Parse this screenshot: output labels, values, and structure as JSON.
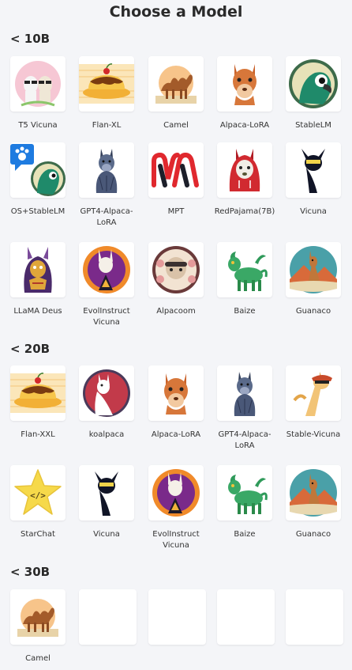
{
  "title": "Choose a Model",
  "sections": [
    {
      "label": "< 10B",
      "models": [
        {
          "name": "T5 Vicuna",
          "icon": "llamas-icon"
        },
        {
          "name": "Flan-XL",
          "icon": "pudding-icon"
        },
        {
          "name": "Camel",
          "icon": "camel-icon"
        },
        {
          "name": "Alpaca-LoRA",
          "icon": "alpaca-icon"
        },
        {
          "name": "StableLM",
          "icon": "parrot-icon"
        },
        {
          "name": "OS+StableLM",
          "icon": "parrot-paw-icon"
        },
        {
          "name": "GPT4-Alpaca-LoRA",
          "icon": "sketch-alpaca-icon"
        },
        {
          "name": "MPT",
          "icon": "mpt-logo-icon"
        },
        {
          "name": "RedPajama(7B)",
          "icon": "red-hoodie-llama-icon"
        },
        {
          "name": "Vicuna",
          "icon": "vicuna-icon"
        },
        {
          "name": "LLaMA Deus",
          "icon": "llama-deus-icon"
        },
        {
          "name": "EvolInstruct Vicuna",
          "icon": "evol-llama-icon"
        },
        {
          "name": "Alpacoom",
          "icon": "alpacoom-icon"
        },
        {
          "name": "Baize",
          "icon": "baize-icon"
        },
        {
          "name": "Guanaco",
          "icon": "guanaco-icon"
        }
      ]
    },
    {
      "label": "< 20B",
      "models": [
        {
          "name": "Flan-XXL",
          "icon": "pudding-icon"
        },
        {
          "name": "koalpaca",
          "icon": "koalpaca-icon"
        },
        {
          "name": "Alpaca-LoRA",
          "icon": "alpaca-icon"
        },
        {
          "name": "GPT4-Alpaca-LoRA",
          "icon": "sketch-alpaca-icon"
        },
        {
          "name": "Stable-Vicuna",
          "icon": "stable-vicuna-icon"
        },
        {
          "name": "StarChat",
          "icon": "star-icon"
        },
        {
          "name": "Vicuna",
          "icon": "vicuna-icon"
        },
        {
          "name": "EvolInstruct Vicuna",
          "icon": "evol-llama-icon"
        },
        {
          "name": "Baize",
          "icon": "baize-icon"
        },
        {
          "name": "Guanaco",
          "icon": "guanaco-icon"
        }
      ]
    },
    {
      "label": "< 30B",
      "models": [
        {
          "name": "Camel",
          "icon": "camel-icon"
        },
        {
          "name": "",
          "icon": ""
        },
        {
          "name": "",
          "icon": ""
        },
        {
          "name": "",
          "icon": ""
        },
        {
          "name": "",
          "icon": ""
        }
      ]
    }
  ]
}
